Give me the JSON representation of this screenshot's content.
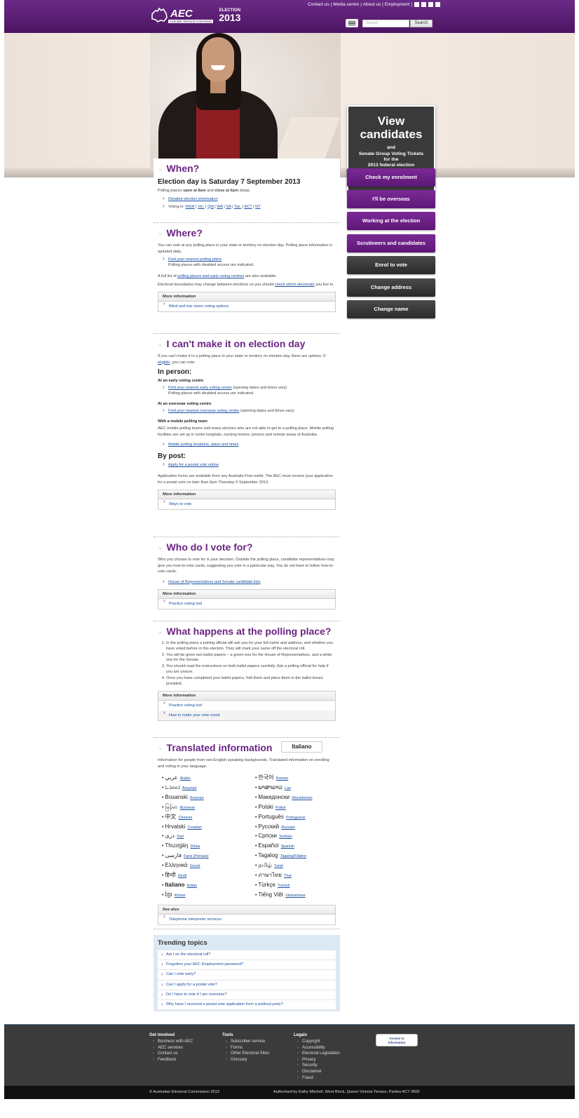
{
  "header": {
    "top_links": [
      "Contact us",
      "Media centre",
      "About us",
      "Employment"
    ],
    "social_icons": [
      "twitter-icon",
      "facebook-icon",
      "youtube-icon",
      "rss-icon"
    ],
    "logo_text": "AEC",
    "logo_subtitle": "Australian Electoral Commission",
    "election_label": "ELECTION",
    "election_year": "2013",
    "search_placeholder": "Search",
    "search_button": "Search"
  },
  "hero": {
    "title": "View candidates",
    "subtitle_and": "and",
    "subtitle_1": "Senate Group Voting Tickets",
    "subtitle_2": "for the",
    "subtitle_3": "2013 federal election",
    "dots": "●○●●"
  },
  "side_buttons": [
    {
      "label": "Check my enrolment",
      "color": "#6b2483"
    },
    {
      "label": "I'll be overseas",
      "color": "#6b2483"
    },
    {
      "label": "Working at the election",
      "color": "#6b2483"
    },
    {
      "label": "Scrutineers and candidates",
      "color": "#6b2483"
    },
    {
      "label": "Enrol to vote",
      "color": "#333333"
    },
    {
      "label": "Change address",
      "color": "#333333"
    },
    {
      "label": "Change name",
      "color": "#333333"
    }
  ],
  "when": {
    "heading": "When?",
    "subheading": "Election day is Saturday 7 September 2013",
    "p1_a": "Polling places ",
    "p1_b": "open at 8am",
    "p1_c": " and ",
    "p1_d": "close at 6pm",
    "p1_e": " sharp.",
    "link1": "Detailed election information",
    "voting_in": "Voting in:",
    "states": [
      "NSW",
      "Vic.",
      "Qld",
      "WA",
      "SA",
      "Tas.",
      "ACT",
      "NT"
    ]
  },
  "where": {
    "heading": "Where?",
    "p1": "You can vote at any polling place in your state or territory on election day. Polling place information is updated daily.",
    "link1": "Find your nearest polling place",
    "link1_sub": "Polling places with disabled access are indicated.",
    "p2_a": "A full list of ",
    "p2_link": "polling places and early voting centres",
    "p2_b": " are also available.",
    "p3_a": "Electoral boundaries may change between elections so you should ",
    "p3_link": "check which electorate",
    "p3_b": " you live in.",
    "more_title": "More information",
    "more_items": [
      "Blind and low vision voting options"
    ]
  },
  "cant": {
    "heading": "I can't make it on election day",
    "p1_a": "If you can't make it to a polling place in your state or territory on election day, there are options. If ",
    "p1_link": "eligible",
    "p1_b": ", you can vote:",
    "in_person": "In person:",
    "early_h": "At an early voting centre",
    "early_link": "Find your nearest early voting centre",
    "early_after": " (opening dates and times vary)",
    "early_sub": "Polling places with disabled access are indicated.",
    "overseas_h": "At an overseas voting centre",
    "overseas_link": "Find your nearest overseas voting centre",
    "overseas_after": " (opening dates and times vary)",
    "mobile_h": "With a mobile polling team",
    "mobile_p": "AEC mobile polling teams visit many electors who are not able to get to a polling place. Mobile polling facilities are set up in some hospitals, nursing homes, prisons and remote areas of Australia.",
    "mobile_link": "Mobile polling locations, dates and times",
    "by_post": "By post:",
    "post_link": "Apply for a postal vote online",
    "post_p": "Application forms are available from any Australia Post outlet. The AEC must receive your application for a postal vote no later than 6pm Thursday 5 September 2013.",
    "more_title": "More information",
    "more_items": [
      "Ways to vote"
    ]
  },
  "who": {
    "heading": "Who do I vote for?",
    "p1": "Who you choose to vote for is your decision. Outside the polling place, candidate representatives may give you how-to-vote cards, suggesting you vote in a particular way. You do not have to follow how-to-vote cards.",
    "link1": "House of Representatives and Senate candidate lists",
    "more_title": "More information",
    "more_items": [
      "Practice voting tool"
    ]
  },
  "polling": {
    "heading": "What happens at the polling place?",
    "steps": [
      "In the polling place a polling official will ask you for your full name and address, and whether you have voted before in this election. They will mark your name off the electoral roll.",
      "You will be given two ballot papers – a green one for the House of Representatives, and a white one for the Senate.",
      "You should read the instructions on both ballot papers carefully. Ask a polling official for help if you are unsure.",
      "Once you have completed your ballot papers, fold them and place them in the ballot boxes provided."
    ],
    "more_title": "More information",
    "more_items": [
      "Practice voting tool",
      "How to make your vote count"
    ]
  },
  "translated": {
    "heading": "Translated information",
    "selected_language": "Italiano",
    "p1": "Information for people from non-English speaking backgrounds. Translated information on enrolling and voting in your language.",
    "languages_left": [
      {
        "native": "عربي",
        "english": "Arabic"
      },
      {
        "native": "ܐܬܘܪܝܐ",
        "english": "Assyrian"
      },
      {
        "native": "Bosanski",
        "english": "Bosnian"
      },
      {
        "native": "မြန်မာ",
        "english": "Burmese"
      },
      {
        "native": "中文",
        "english": "Chinese"
      },
      {
        "native": "Hrvatski",
        "english": "Croatian"
      },
      {
        "native": "دری",
        "english": "Dari"
      },
      {
        "native": "Thuɔŋjäŋ",
        "english": "Dinka"
      },
      {
        "native": "فارسی",
        "english": "Farsi (Persian)"
      },
      {
        "native": "Ελληνικά",
        "english": "Greek"
      },
      {
        "native": "हिन्दी",
        "english": "Hindi"
      },
      {
        "native": "Italiano",
        "english": "Italian"
      },
      {
        "native": "ខ្មែរ",
        "english": "Khmer"
      }
    ],
    "languages_right": [
      {
        "native": "한국어",
        "english": "Korean"
      },
      {
        "native": "ພາສາລາວ",
        "english": "Lao"
      },
      {
        "native": "Македонски",
        "english": "Macedonian"
      },
      {
        "native": "Polski",
        "english": "Polish"
      },
      {
        "native": "Português",
        "english": "Portuguese"
      },
      {
        "native": "Русский",
        "english": "Russian"
      },
      {
        "native": "Српски",
        "english": "Serbian"
      },
      {
        "native": "Español",
        "english": "Spanish"
      },
      {
        "native": "Tagalog",
        "english": "Tagalog/Filipino"
      },
      {
        "native": "தமிழ்",
        "english": "Tamil"
      },
      {
        "native": "ภาษาไทย",
        "english": "Thai"
      },
      {
        "native": "Türkçe",
        "english": "Turkish"
      },
      {
        "native": "Tiếng Việt",
        "english": "Vietnamese"
      }
    ],
    "see_also_title": "See also",
    "see_also_items": [
      "Telephone interpreter services"
    ]
  },
  "trending": {
    "heading": "Trending topics",
    "items": [
      "Am I on the electoral roll?",
      "Forgotten your AEC Employment password?",
      "Can I vote early?",
      "Can I apply for a postal vote?",
      "Do I have to vote if I am overseas?",
      "Why have I received a postal vote application from a political party?"
    ]
  },
  "footer": {
    "get_involved_title": "Get involved",
    "get_involved": [
      "Business with AEC",
      "AEC services",
      "Contact us",
      "Feedback"
    ],
    "tools_title": "Tools",
    "tools": [
      "Subscriber service",
      "Forms",
      "Other Electoral Sites",
      "Glossary"
    ],
    "legals_title": "Legals",
    "legals": [
      "Copyright",
      "Accessibility",
      "Electoral Legislation",
      "Privacy",
      "Security",
      "Disclaimer",
      "Fraud"
    ],
    "access_badge_1": "Access to",
    "access_badge_2": "information",
    "copyright": "© Australian Electoral Commission 2013",
    "authorised": "Authorised by Kathy Mitchell, West Block, Queen Victoria Terrace, Parkes ACT 2600"
  }
}
